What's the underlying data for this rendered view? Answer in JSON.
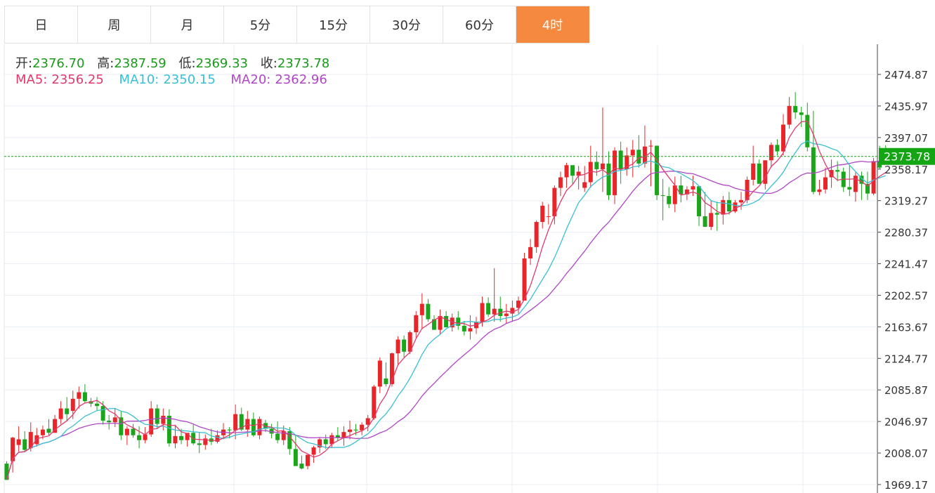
{
  "tabs": [
    {
      "label": "日",
      "active": false
    },
    {
      "label": "周",
      "active": false
    },
    {
      "label": "月",
      "active": false
    },
    {
      "label": "5分",
      "active": false
    },
    {
      "label": "15分",
      "active": false
    },
    {
      "label": "30分",
      "active": false
    },
    {
      "label": "60分",
      "active": false
    },
    {
      "label": "4时",
      "active": true
    }
  ],
  "ohlc": {
    "open_label": "开:",
    "open": "2376.70",
    "high_label": "高:",
    "high": "2387.59",
    "low_label": "低:",
    "low": "2369.33",
    "close_label": "收:",
    "close": "2373.78"
  },
  "ma": {
    "ma5_label": "MA5:",
    "ma5": "2356.25",
    "ma10_label": "MA10:",
    "ma10": "2350.15",
    "ma20_label": "MA20:",
    "ma20": "2362.96"
  },
  "colors": {
    "up": "#e8262a",
    "down": "#1ba51b",
    "ma5": "#e23a6c",
    "ma10": "#39c0d4",
    "ma20": "#b046c7",
    "tab_active": "#f5893f",
    "price_label": "#13a513",
    "value_text": "#1a9a1a"
  },
  "chart_data": {
    "type": "candlestick",
    "y_ticks": [
      "2474.87",
      "2435.97",
      "2397.07",
      "2358.17",
      "2319.27",
      "2280.37",
      "2241.47",
      "2202.57",
      "2163.67",
      "2124.77",
      "2085.87",
      "2046.97",
      "2008.07",
      "1969.17"
    ],
    "ylim": [
      1969.17,
      2474.87
    ],
    "current_price": "2373.78",
    "grid": true,
    "candles": [
      [
        1995,
        1998,
        1975,
        1975
      ],
      [
        1998,
        2028,
        1984,
        2027
      ],
      [
        2018,
        2041,
        2010,
        2025
      ],
      [
        2025,
        2035,
        2010,
        2012
      ],
      [
        2014,
        2046,
        2010,
        2034
      ],
      [
        2019,
        2039,
        2016,
        2030
      ],
      [
        2030,
        2042,
        2025,
        2037
      ],
      [
        2038,
        2050,
        2030,
        2033
      ],
      [
        2033,
        2055,
        2033,
        2050
      ],
      [
        2050,
        2072,
        2044,
        2063
      ],
      [
        2063,
        2077,
        2048,
        2056
      ],
      [
        2060,
        2085,
        2050,
        2075
      ],
      [
        2075,
        2090,
        2063,
        2083
      ],
      [
        2083,
        2093,
        2070,
        2072
      ],
      [
        2072,
        2076,
        2065,
        2069
      ],
      [
        2069,
        2077,
        2060,
        2066
      ],
      [
        2066,
        2072,
        2043,
        2048
      ],
      [
        2048,
        2055,
        2037,
        2046
      ],
      [
        2046,
        2063,
        2040,
        2052
      ],
      [
        2052,
        2060,
        2024,
        2030
      ],
      [
        2030,
        2041,
        2018,
        2038
      ],
      [
        2038,
        2044,
        2027,
        2030
      ],
      [
        2030,
        2041,
        2014,
        2024
      ],
      [
        2024,
        2040,
        2020,
        2031
      ],
      [
        2031,
        2072,
        2028,
        2063
      ],
      [
        2063,
        2068,
        2038,
        2044
      ],
      [
        2044,
        2063,
        2036,
        2054
      ],
      [
        2054,
        2062,
        2016,
        2020
      ],
      [
        2020,
        2043,
        2014,
        2029
      ],
      [
        2029,
        2038,
        2019,
        2024
      ],
      [
        2024,
        2032,
        2016,
        2033
      ],
      [
        2033,
        2043,
        2018,
        2020
      ],
      [
        2020,
        2033,
        2008,
        2018
      ],
      [
        2018,
        2031,
        2012,
        2026
      ],
      [
        2026,
        2038,
        2018,
        2022
      ],
      [
        2022,
        2036,
        2020,
        2030
      ],
      [
        2030,
        2045,
        2025,
        2037
      ],
      [
        2037,
        2040,
        2026,
        2036
      ],
      [
        2036,
        2068,
        2025,
        2056
      ],
      [
        2056,
        2064,
        2035,
        2037
      ],
      [
        2037,
        2060,
        2028,
        2050
      ],
      [
        2050,
        2058,
        2028,
        2030
      ],
      [
        2030,
        2053,
        2025,
        2050
      ],
      [
        2045,
        2049,
        2034,
        2038
      ],
      [
        2038,
        2044,
        2026,
        2032
      ],
      [
        2032,
        2047,
        2020,
        2024
      ],
      [
        2024,
        2042,
        2018,
        2035
      ],
      [
        2035,
        2040,
        2006,
        2013
      ],
      [
        2013,
        2030,
        1995,
        1992
      ],
      [
        1995,
        2005,
        1988,
        1989
      ],
      [
        1992,
        2002,
        1988,
        2006
      ],
      [
        2006,
        2017,
        1996,
        2015
      ],
      [
        2015,
        2027,
        2008,
        2025
      ],
      [
        2025,
        2031,
        2013,
        2019
      ],
      [
        2019,
        2033,
        2015,
        2030
      ],
      [
        2030,
        2040,
        2023,
        2027
      ],
      [
        2027,
        2041,
        2017,
        2034
      ],
      [
        2034,
        2048,
        2025,
        2037
      ],
      [
        2037,
        2044,
        2030,
        2036
      ],
      [
        2036,
        2046,
        2030,
        2043
      ],
      [
        2043,
        2055,
        2035,
        2051
      ],
      [
        2051,
        2092,
        2049,
        2090
      ],
      [
        2090,
        2126,
        2082,
        2122
      ],
      [
        2100,
        2120,
        2090,
        2093
      ],
      [
        2093,
        2132,
        2090,
        2131
      ],
      [
        2131,
        2152,
        2116,
        2148
      ],
      [
        2148,
        2153,
        2126,
        2133
      ],
      [
        2133,
        2159,
        2130,
        2157
      ],
      [
        2157,
        2183,
        2150,
        2178
      ],
      [
        2178,
        2205,
        2162,
        2192
      ],
      [
        2192,
        2198,
        2170,
        2173
      ],
      [
        2173,
        2178,
        2160,
        2160
      ],
      [
        2160,
        2185,
        2154,
        2177
      ],
      [
        2177,
        2183,
        2163,
        2163
      ],
      [
        2163,
        2180,
        2158,
        2175
      ],
      [
        2175,
        2183,
        2160,
        2165
      ],
      [
        2165,
        2171,
        2153,
        2158
      ],
      [
        2158,
        2178,
        2148,
        2162
      ],
      [
        2162,
        2176,
        2155,
        2170
      ],
      [
        2170,
        2201,
        2164,
        2193
      ],
      [
        2193,
        2200,
        2176,
        2179
      ],
      [
        2179,
        2236,
        2170,
        2186
      ],
      [
        2186,
        2201,
        2170,
        2177
      ],
      [
        2177,
        2192,
        2168,
        2180
      ],
      [
        2180,
        2196,
        2170,
        2187
      ],
      [
        2187,
        2201,
        2180,
        2196
      ],
      [
        2196,
        2255,
        2196,
        2248
      ],
      [
        2248,
        2272,
        2240,
        2262
      ],
      [
        2262,
        2295,
        2255,
        2293
      ],
      [
        2293,
        2318,
        2285,
        2313
      ],
      [
        2300,
        2315,
        2290,
        2300
      ],
      [
        2300,
        2338,
        2290,
        2335
      ],
      [
        2335,
        2355,
        2325,
        2348
      ],
      [
        2348,
        2366,
        2335,
        2363
      ],
      [
        2363,
        2360,
        2340,
        2350
      ],
      [
        2350,
        2362,
        2333,
        2355
      ],
      [
        2335,
        2362,
        2330,
        2342
      ],
      [
        2342,
        2387,
        2335,
        2367
      ],
      [
        2367,
        2380,
        2350,
        2358
      ],
      [
        2358,
        2434,
        2330,
        2365
      ],
      [
        2365,
        2380,
        2320,
        2326
      ],
      [
        2326,
        2385,
        2315,
        2381
      ],
      [
        2381,
        2392,
        2340,
        2358
      ],
      [
        2358,
        2385,
        2350,
        2375
      ],
      [
        2375,
        2394,
        2348,
        2382
      ],
      [
        2382,
        2400,
        2360,
        2365
      ],
      [
        2365,
        2412,
        2360,
        2386
      ],
      [
        2386,
        2394,
        2337,
        2387
      ],
      [
        2387,
        2380,
        2320,
        2326
      ],
      [
        2326,
        2346,
        2295,
        2325
      ],
      [
        2325,
        2336,
        2310,
        2315
      ],
      [
        2315,
        2349,
        2305,
        2338
      ],
      [
        2338,
        2350,
        2317,
        2327
      ],
      [
        2327,
        2337,
        2320,
        2333
      ],
      [
        2333,
        2350,
        2325,
        2337
      ],
      [
        2337,
        2337,
        2288,
        2300
      ],
      [
        2300,
        2330,
        2287,
        2287
      ],
      [
        2287,
        2320,
        2283,
        2304
      ],
      [
        2304,
        2318,
        2282,
        2302
      ],
      [
        2302,
        2325,
        2290,
        2320
      ],
      [
        2320,
        2330,
        2302,
        2306
      ],
      [
        2306,
        2320,
        2304,
        2317
      ],
      [
        2317,
        2330,
        2308,
        2320
      ],
      [
        2320,
        2349,
        2316,
        2345
      ],
      [
        2345,
        2387,
        2338,
        2365
      ],
      [
        2365,
        2370,
        2340,
        2340
      ],
      [
        2340,
        2369,
        2333,
        2369
      ],
      [
        2369,
        2391,
        2360,
        2388
      ],
      [
        2388,
        2395,
        2375,
        2380
      ],
      [
        2380,
        2426,
        2375,
        2413
      ],
      [
        2413,
        2447,
        2408,
        2436
      ],
      [
        2436,
        2453,
        2420,
        2428
      ],
      [
        2428,
        2435,
        2410,
        2425
      ],
      [
        2425,
        2440,
        2380,
        2385
      ],
      [
        2385,
        2430,
        2327,
        2330
      ],
      [
        2330,
        2345,
        2326,
        2333
      ],
      [
        2333,
        2360,
        2328,
        2348
      ],
      [
        2348,
        2370,
        2335,
        2357
      ],
      [
        2357,
        2368,
        2343,
        2355
      ],
      [
        2355,
        2360,
        2330,
        2336
      ],
      [
        2336,
        2363,
        2325,
        2333
      ],
      [
        2330,
        2354,
        2318,
        2350
      ],
      [
        2350,
        2355,
        2320,
        2340
      ],
      [
        2340,
        2355,
        2320,
        2328
      ],
      [
        2328,
        2372,
        2326,
        2368
      ],
      [
        2368,
        2387,
        2358,
        2360
      ],
      [
        2376.7,
        2387.59,
        2369.33,
        2373.78
      ]
    ]
  }
}
